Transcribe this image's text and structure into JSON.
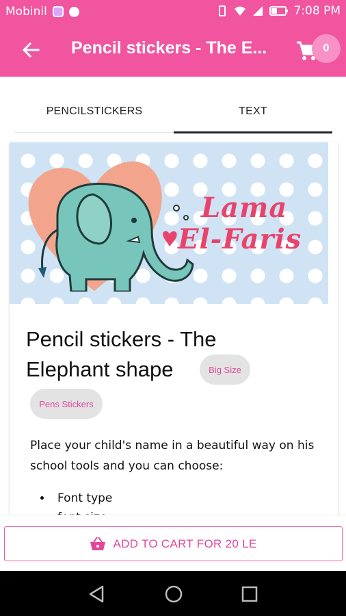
{
  "status_bar": {
    "carrier": "Mobinil",
    "time": "7:08 PM"
  },
  "app_bar": {
    "title": "Pencil stickers - The E...",
    "cart_count": "0"
  },
  "tabs": [
    {
      "label": "PENCILSTICKERS",
      "active": false
    },
    {
      "label": "TEXT",
      "active": true
    }
  ],
  "banner": {
    "line1": "Lama",
    "line2": "El-Faris"
  },
  "product": {
    "title": "Pencil stickers - The Elephant shape",
    "chips": [
      "Big Size",
      "Pens Stickers"
    ],
    "description": "Place your child's name in a beautiful way on his school tools and you can choose:",
    "options": [
      "Font type",
      "font size"
    ]
  },
  "cta": {
    "label": "ADD TO CART FOR 20 LE"
  },
  "colors": {
    "accent": "#f1559f",
    "chip_text": "#e0479d",
    "banner_text": "#e9436c"
  },
  "icons": [
    "back-arrow-icon",
    "cart-icon",
    "basket-icon",
    "nav-back-icon",
    "nav-home-icon",
    "nav-recents-icon"
  ]
}
